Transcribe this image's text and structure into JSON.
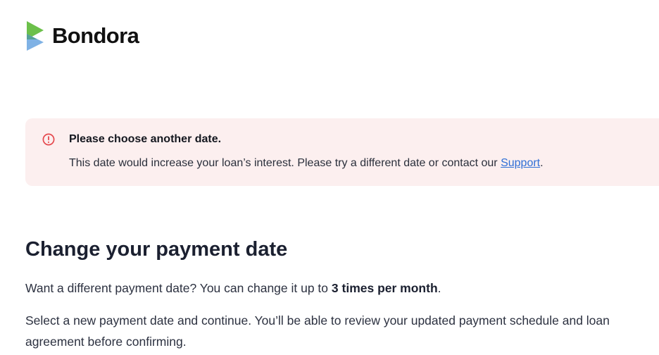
{
  "brand": {
    "name": "Bondora",
    "logo_colors": {
      "green": "#6cc04a",
      "blue": "#7fb2e5"
    }
  },
  "alert": {
    "icon": "error-circle-icon",
    "icon_color": "#e5484d",
    "title": "Please choose another date.",
    "body_prefix": "This date would increase your loan’s interest. Please try a different date or contact our ",
    "link_text": "Support",
    "body_suffix": ".",
    "background": "#fcefef"
  },
  "main": {
    "heading": "Change your payment date",
    "intro_prefix": "Want a different payment date? You can change it up to ",
    "intro_bold": "3 times per month",
    "intro_suffix": ".",
    "instructions": "Select a new payment date and continue. You’ll be able to review your updated payment schedule and loan agreement before confirming."
  }
}
